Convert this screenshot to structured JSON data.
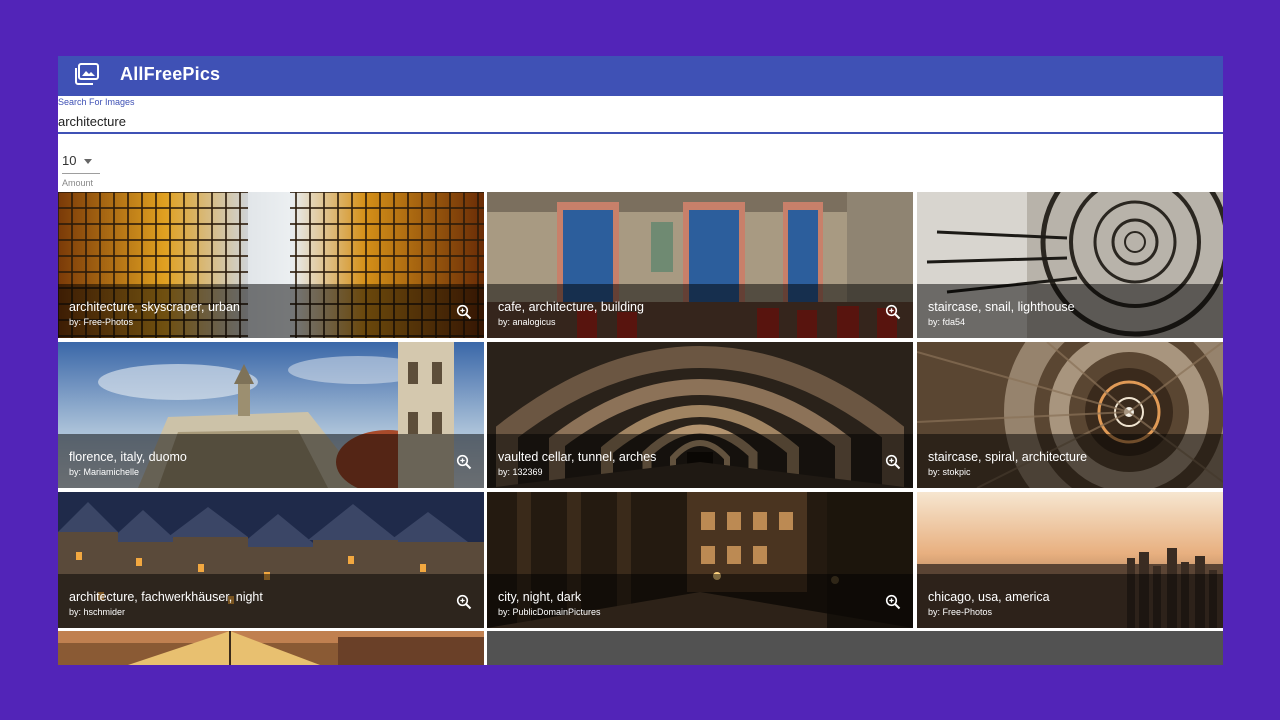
{
  "app": {
    "title": "AllFreePics",
    "icon": "photo-library-icon",
    "accent": "#3f51b5"
  },
  "search": {
    "label": "Search For Images",
    "value": "architecture"
  },
  "amount": {
    "value": "10",
    "label": "Amount"
  },
  "images": [
    {
      "title": "architecture, skyscraper, urban",
      "author": "by: Free-Photos"
    },
    {
      "title": "cafe, architecture, building",
      "author": "by: analogicus"
    },
    {
      "title": "staircase, snail, lighthouse",
      "author": "by: fda54"
    },
    {
      "title": "florence, italy, duomo",
      "author": "by: Mariamichelle"
    },
    {
      "title": "vaulted cellar, tunnel, arches",
      "author": "by: 132369"
    },
    {
      "title": "staircase, spiral, architecture",
      "author": "by: stokpic"
    },
    {
      "title": "architecture, fachwerkhäuser, night",
      "author": "by: hschmider"
    },
    {
      "title": "city, night, dark",
      "author": "by: PublicDomainPictures"
    },
    {
      "title": "chicago, usa, america",
      "author": "by: Free-Photos"
    }
  ]
}
